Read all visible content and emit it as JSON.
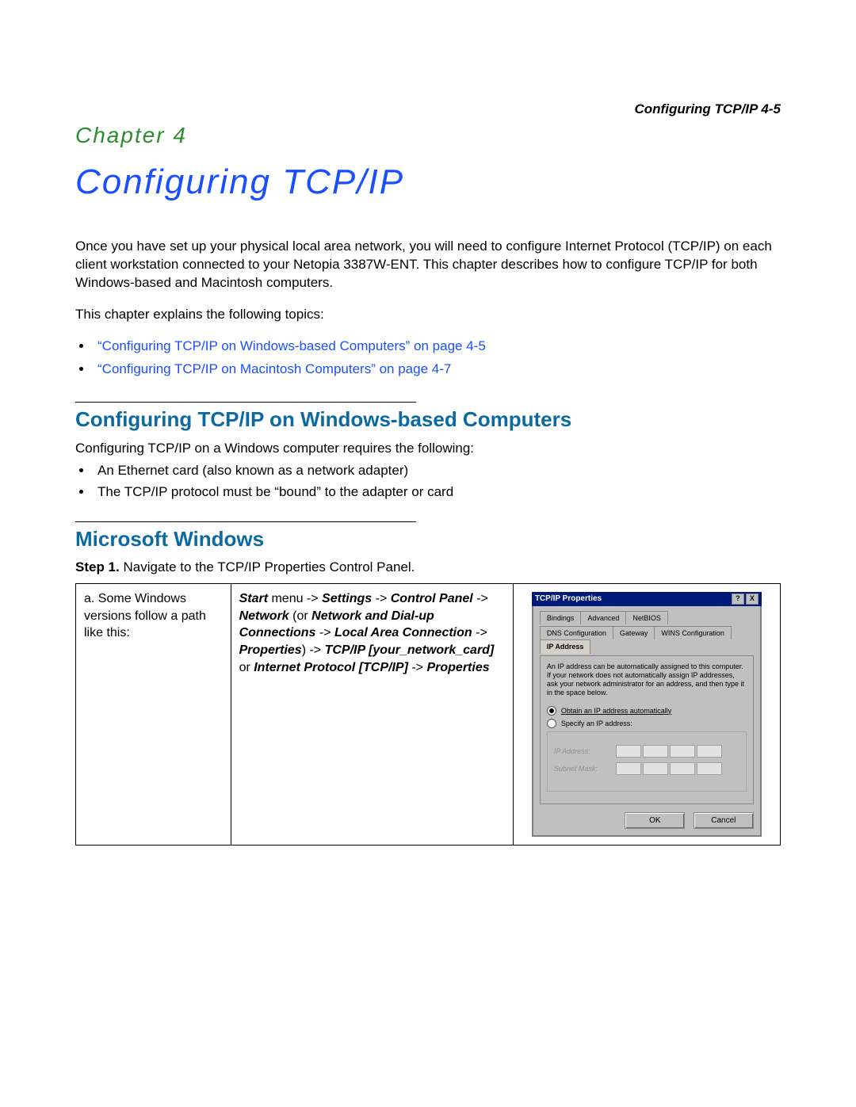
{
  "runningHead": "Configuring TCP/IP   4-5",
  "chapterLabel": "Chapter 4",
  "chapterTitle": "Configuring TCP/IP",
  "intro": "Once you have set up your physical local area network, you will need to configure Internet Protocol (TCP/IP) on each client workstation connected to your Netopia 3387W-ENT. This chapter describes how to configure TCP/IP for both Windows-based and Macintosh computers.",
  "topicsLead": "This chapter explains the following topics:",
  "topicLinks": [
    "“Configuring TCP/IP on Windows-based Computers” on page 4-5",
    "“Configuring TCP/IP on Macintosh Computers” on page 4-7"
  ],
  "section1": {
    "heading": "Configuring TCP/IP on Windows-based Computers",
    "lead": "Configuring TCP/IP on a Windows computer requires the following:",
    "items": [
      "An Ethernet card (also known as a network adapter)",
      "The TCP/IP protocol must be “bound” to the adapter or card"
    ]
  },
  "section2": {
    "heading": "Microsoft Windows",
    "stepLabel": "Step 1.",
    "stepText": " Navigate to the TCP/IP Properties Control Panel."
  },
  "table": {
    "a": "a. Some Windows versions follow a path like this:",
    "path": {
      "p1": "Start",
      "p2": " menu -> ",
      "p3": "Settings",
      "p4": " -> ",
      "p5": "Control Panel",
      "p6": " -> ",
      "p7": "Network",
      "p8": " (or ",
      "p9": "Network and Dial-up Connections",
      "p10": " -> ",
      "p11": "Local Area Connection",
      "p12": " -> ",
      "p13": "Properties",
      "p14": ") -> ",
      "p15": "TCP/IP [your_network_card]",
      "p16": " or ",
      "p17": "Internet Protocol [TCP/IP]",
      "p18": " -> ",
      "p19": "Properties"
    }
  },
  "dialog": {
    "title": "TCP/IP Properties",
    "tabs": {
      "row1": [
        "Bindings",
        "Advanced",
        "NetBIOS"
      ],
      "row2": [
        "DNS Configuration",
        "Gateway",
        "WINS Configuration",
        "IP Address"
      ]
    },
    "desc": "An IP address can be automatically assigned to this computer. If your network does not automatically assign IP addresses, ask your network administrator for an address, and then type it in the space below.",
    "optAuto": "Obtain an IP address automatically",
    "optManual": "Specify an IP address:",
    "lblIP": "IP Address:",
    "lblMask": "Subnet Mask:",
    "ok": "OK",
    "cancel": "Cancel",
    "help": "?",
    "close": "X"
  }
}
